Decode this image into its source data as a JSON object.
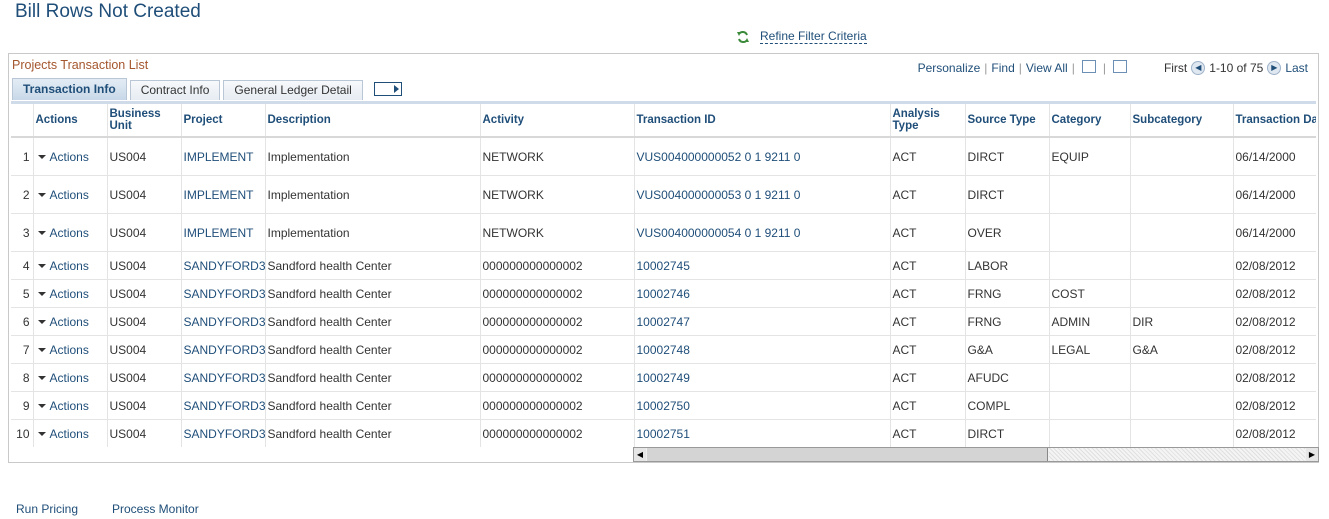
{
  "page": {
    "title": "Bill Rows Not Created"
  },
  "refine": {
    "label": "Refine Filter Criteria",
    "icon": "refresh-icon"
  },
  "grid": {
    "title": "Projects Transaction List",
    "nav": {
      "personalize": "Personalize",
      "find": "Find",
      "view_all": "View All",
      "first": "First",
      "range": "1-10 of 75",
      "last": "Last"
    },
    "tabs": [
      "Transaction Info",
      "Contract Info",
      "General Ledger Detail"
    ],
    "active_tab": "Transaction Info",
    "columns": [
      "",
      "Actions",
      "Business Unit",
      "Project",
      "Description",
      "Activity",
      "Transaction ID",
      "Analysis Type",
      "Source Type",
      "Category",
      "Subcategory",
      "Transaction Date"
    ],
    "rows": [
      {
        "n": "1",
        "actions": "Actions",
        "bu": "US004",
        "project": "IMPLEMENT",
        "desc": "Implementation",
        "activity": "NETWORK",
        "txn": "VUS004000000052 0 1 9211 0",
        "atype": "ACT",
        "stype": "DIRCT",
        "cat": "EQUIP",
        "subcat": "",
        "date": "06/14/2000"
      },
      {
        "n": "2",
        "actions": "Actions",
        "bu": "US004",
        "project": "IMPLEMENT",
        "desc": "Implementation",
        "activity": "NETWORK",
        "txn": "VUS004000000053 0 1 9211 0",
        "atype": "ACT",
        "stype": "DIRCT",
        "cat": "",
        "subcat": "",
        "date": "06/14/2000"
      },
      {
        "n": "3",
        "actions": "Actions",
        "bu": "US004",
        "project": "IMPLEMENT",
        "desc": "Implementation",
        "activity": "NETWORK",
        "txn": "VUS004000000054 0 1 9211 0",
        "atype": "ACT",
        "stype": "OVER",
        "cat": "",
        "subcat": "",
        "date": "06/14/2000"
      },
      {
        "n": "4",
        "actions": "Actions",
        "bu": "US004",
        "project": "SANDYFORD3",
        "desc": "Sandford health Center",
        "activity": "000000000000002",
        "txn": "10002745",
        "atype": "ACT",
        "stype": "LABOR",
        "cat": "",
        "subcat": "",
        "date": "02/08/2012"
      },
      {
        "n": "5",
        "actions": "Actions",
        "bu": "US004",
        "project": "SANDYFORD3",
        "desc": "Sandford health Center",
        "activity": "000000000000002",
        "txn": "10002746",
        "atype": "ACT",
        "stype": "FRNG",
        "cat": "COST",
        "subcat": "",
        "date": "02/08/2012"
      },
      {
        "n": "6",
        "actions": "Actions",
        "bu": "US004",
        "project": "SANDYFORD3",
        "desc": "Sandford health Center",
        "activity": "000000000000002",
        "txn": "10002747",
        "atype": "ACT",
        "stype": "FRNG",
        "cat": "ADMIN",
        "subcat": "DIR",
        "date": "02/08/2012"
      },
      {
        "n": "7",
        "actions": "Actions",
        "bu": "US004",
        "project": "SANDYFORD3",
        "desc": "Sandford health Center",
        "activity": "000000000000002",
        "txn": "10002748",
        "atype": "ACT",
        "stype": "G&A",
        "cat": "LEGAL",
        "subcat": "G&A",
        "date": "02/08/2012"
      },
      {
        "n": "8",
        "actions": "Actions",
        "bu": "US004",
        "project": "SANDYFORD3",
        "desc": "Sandford health Center",
        "activity": "000000000000002",
        "txn": "10002749",
        "atype": "ACT",
        "stype": "AFUDC",
        "cat": "",
        "subcat": "",
        "date": "02/08/2012"
      },
      {
        "n": "9",
        "actions": "Actions",
        "bu": "US004",
        "project": "SANDYFORD3",
        "desc": "Sandford health Center",
        "activity": "000000000000002",
        "txn": "10002750",
        "atype": "ACT",
        "stype": "COMPL",
        "cat": "",
        "subcat": "",
        "date": "02/08/2012"
      },
      {
        "n": "10",
        "actions": "Actions",
        "bu": "US004",
        "project": "SANDYFORD3",
        "desc": "Sandford health Center",
        "activity": "000000000000002",
        "txn": "10002751",
        "atype": "ACT",
        "stype": "DIRCT",
        "cat": "",
        "subcat": "",
        "date": "02/08/2012"
      }
    ]
  },
  "footer": {
    "run_pricing": "Run Pricing",
    "process_monitor": "Process Monitor"
  },
  "colors": {
    "link": "#1f4e79",
    "grid_title": "#a4562d"
  }
}
